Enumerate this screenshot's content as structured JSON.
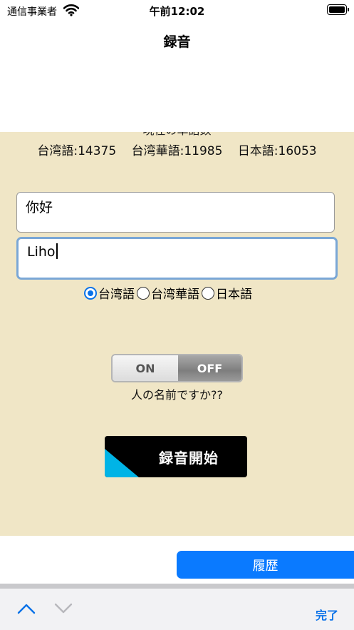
{
  "status_bar": {
    "carrier": "通信事業者",
    "time": "午前12:02",
    "wifi_icon": "wifi-icon",
    "battery_icon": "battery-icon"
  },
  "nav": {
    "title": "録音"
  },
  "counts": {
    "heading": "現在の単語数",
    "taiwanese": "台湾語:14375",
    "taiwan_mandarin": "台湾華語:11985",
    "japanese": "日本語:16053"
  },
  "fields": {
    "word": "你好",
    "reading": "Liho"
  },
  "language_options": [
    {
      "label": "台湾語",
      "selected": true
    },
    {
      "label": "台湾華語",
      "selected": false
    },
    {
      "label": "日本語",
      "selected": false
    }
  ],
  "toggle": {
    "on_label": "ON",
    "off_label": "OFF",
    "state": "OFF",
    "caption": "人の名前ですか??"
  },
  "record_button": {
    "label": "録音開始"
  },
  "history_button": {
    "label": "履歴"
  },
  "accessory": {
    "done_label": "完了",
    "up_icon": "chevron-up-icon",
    "down_icon": "chevron-down-icon"
  },
  "colors": {
    "background": "#f0e6c6",
    "accent": "#0a7aff",
    "record_accent": "#00b4e6"
  }
}
